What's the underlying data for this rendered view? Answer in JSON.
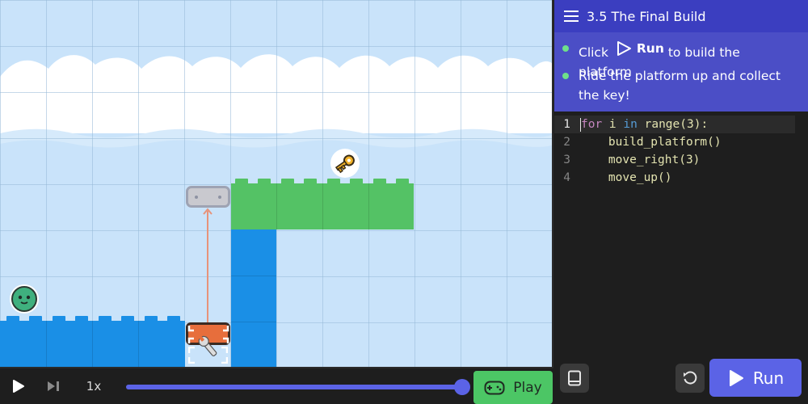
{
  "lesson": {
    "title": "3.5 The Final Build",
    "bullets": [
      {
        "prefix": "Click",
        "emphasis": "Run",
        "suffix": "to build the platform"
      },
      {
        "text": "Ride the platform up and collect the key!"
      }
    ]
  },
  "editor": {
    "lines": [
      {
        "number": "1"
      },
      {
        "number": "2",
        "text": "    build_platform()"
      },
      {
        "number": "3",
        "text": "    move_right(3)"
      },
      {
        "number": "4",
        "text": "    move_up()"
      }
    ],
    "line1": {
      "kw_for": "for",
      "var": " i ",
      "kw_in": "in",
      "call": " range(3):"
    }
  },
  "controls": {
    "speed": "1x",
    "progress": 1.0,
    "play_label": "Play",
    "run_label": "Run"
  },
  "icons": {
    "menu": "hamburger-menu-icon",
    "run_inline": "play-outline-icon",
    "play": "play-icon",
    "step": "step-forward-icon",
    "gamepad": "gamepad-icon",
    "book": "book-icon",
    "reset": "reset-icon"
  },
  "colors": {
    "accent": "#5b63e6",
    "play_green": "#4cc665",
    "instruction_bg": "#4b4ec6",
    "bullet": "#6ee08a",
    "block_blue": "#1a8fe6",
    "block_green": "#54c265",
    "builder_orange": "#e76e3c"
  }
}
